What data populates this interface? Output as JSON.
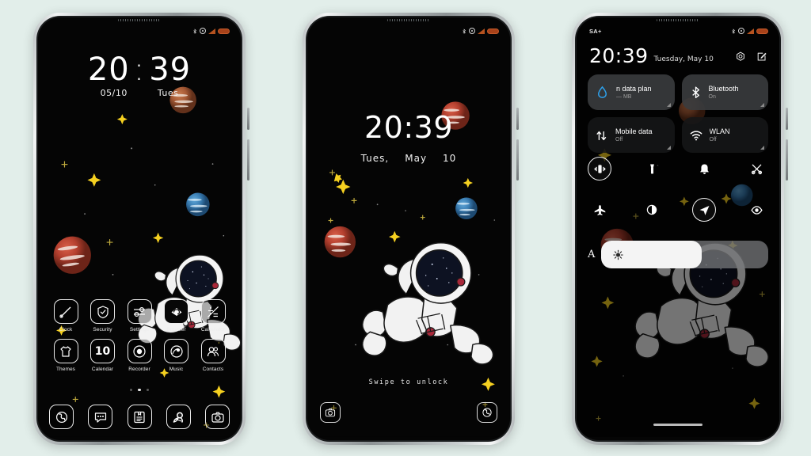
{
  "background_color": "#e2eeea",
  "phone1": {
    "name": "home-screen",
    "statusbar": {
      "left": "",
      "icons": [
        "bluetooth-icon",
        "alarm-icon",
        "signal-icon",
        "battery-icon"
      ]
    },
    "clock": {
      "hours": "20",
      "colon": ":",
      "minutes": "39",
      "date": "05/10",
      "weekday": "Tues"
    },
    "apps_row1": [
      {
        "label": "Clock",
        "icon": "clock-icon"
      },
      {
        "label": "Security",
        "icon": "shield-icon"
      },
      {
        "label": "Settings",
        "icon": "sliders-icon"
      },
      {
        "label": "Browser",
        "icon": "globe-icon"
      },
      {
        "label": "Calculator",
        "icon": "calculator-icon"
      }
    ],
    "apps_row2": [
      {
        "label": "Themes",
        "icon": "tshirt-icon"
      },
      {
        "label": "Calendar",
        "icon": "calendar-icon",
        "day": "10"
      },
      {
        "label": "Recorder",
        "icon": "record-icon"
      },
      {
        "label": "Music",
        "icon": "music-disc-icon"
      },
      {
        "label": "Contacts",
        "icon": "contacts-icon"
      }
    ],
    "page_dots": {
      "count": 3,
      "active_index": 1
    },
    "dock": [
      {
        "icon": "phone-icon"
      },
      {
        "icon": "messages-icon"
      },
      {
        "icon": "notes-icon"
      },
      {
        "icon": "astronaut-gallery-icon"
      },
      {
        "icon": "camera-icon"
      }
    ]
  },
  "phone2": {
    "name": "lock-screen",
    "statusbar": {
      "icons": [
        "bluetooth-icon",
        "alarm-icon",
        "signal-icon",
        "battery-icon"
      ]
    },
    "clock": {
      "time": "20:39",
      "weekday": "Tues,",
      "month": "May",
      "day": "10"
    },
    "hint": "Swipe to unlock",
    "shortcut_left": {
      "icon": "camera-icon"
    },
    "shortcut_right": {
      "icon": "phone-icon"
    }
  },
  "phone3": {
    "name": "control-center",
    "statusbar": {
      "carrier": "SA+",
      "icons": [
        "bluetooth-icon",
        "alarm-icon",
        "signal-icon",
        "battery-icon"
      ]
    },
    "header": {
      "time": "20:39",
      "date": "Tuesday, May 10",
      "settings_icon": "gear-icon",
      "edit_icon": "edit-icon"
    },
    "tiles": [
      {
        "title": "n data plan",
        "subtitle": "— MB",
        "icon": "data-drop-icon",
        "active": true
      },
      {
        "title": "Bluetooth",
        "subtitle": "On",
        "icon": "bluetooth-icon",
        "active": true
      },
      {
        "title": "Mobile data",
        "subtitle": "Off",
        "icon": "mobile-data-icon",
        "active": false
      },
      {
        "title": "WLAN",
        "subtitle": "Off",
        "icon": "wifi-icon",
        "active": false
      }
    ],
    "quick_row1": [
      {
        "icon": "vibrate-icon",
        "on": true
      },
      {
        "icon": "flashlight-icon",
        "on": false
      },
      {
        "icon": "bell-icon",
        "on": false
      },
      {
        "icon": "screenshot-icon",
        "on": false
      }
    ],
    "quick_row2": [
      {
        "icon": "airplane-icon",
        "on": false
      },
      {
        "icon": "dark-mode-icon",
        "on": false
      },
      {
        "icon": "location-icon",
        "on": true
      },
      {
        "icon": "eye-care-icon",
        "on": false
      }
    ],
    "brightness": {
      "auto_label": "A",
      "icon": "sun-icon",
      "percent": 60
    },
    "home_indicator": true
  },
  "theme": {
    "accent_yellow": "#f5d020",
    "planet_red": "#b5402f",
    "planet_blue": "#3b7fb5",
    "planet_orange": "#a75b36",
    "tile_on": "#3a3c3e",
    "tile_off": "#161718"
  }
}
